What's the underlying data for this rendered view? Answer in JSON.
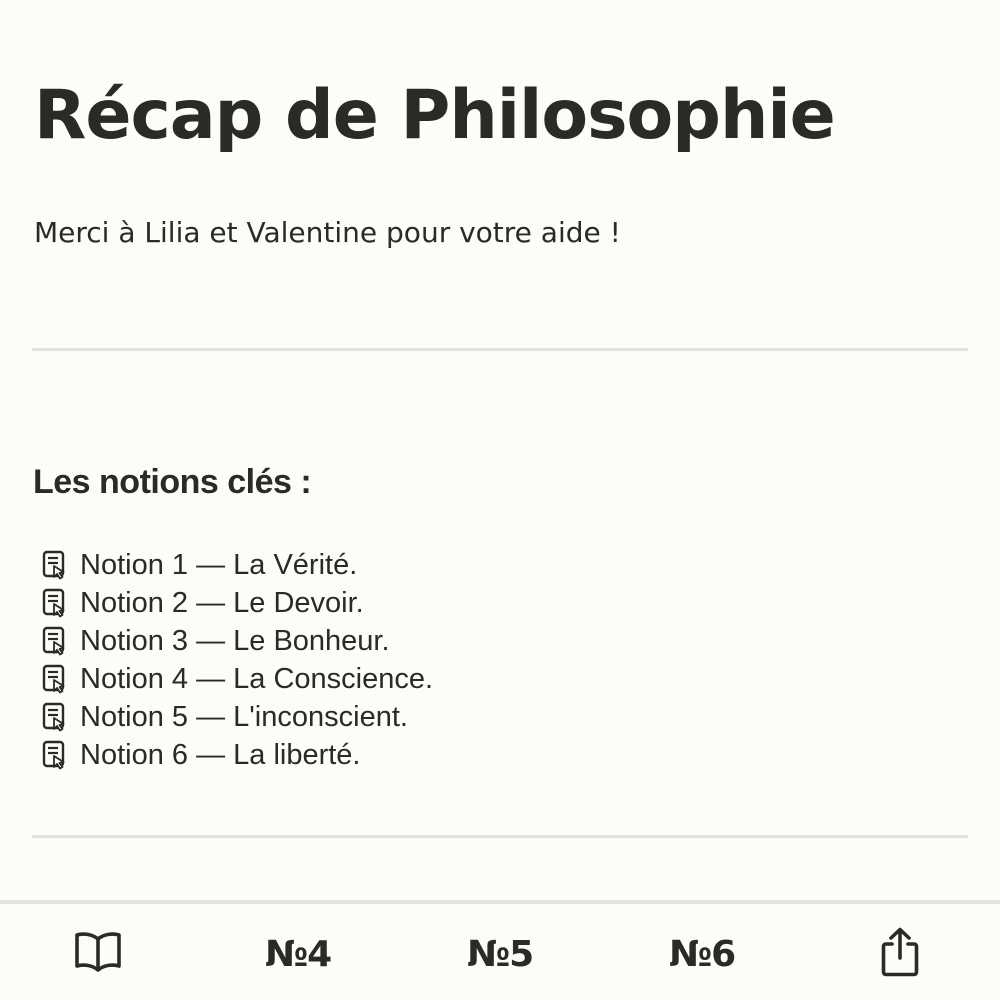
{
  "header": {
    "title": "Récap de Philosophie",
    "subtitle": "Merci à Lilia et Valentine pour votre aide !"
  },
  "notions": {
    "heading": "Les notions clés :",
    "icon": "document-pointer-icon",
    "items": [
      "Notion 1 — La Vérité.",
      "Notion 2 — Le Devoir.",
      "Notion 3 — Le Bonheur.",
      "Notion 4 — La Conscience.",
      "Notion 5 — L'inconscient.",
      "Notion 6 — La liberté."
    ]
  },
  "bottom_bar": {
    "book_icon": "open-book-icon",
    "items": [
      "№4",
      "№5",
      "№6"
    ],
    "share_icon": "share-icon"
  },
  "colors": {
    "background": "#fdfcf8",
    "text": "#2b2a26",
    "divider": "#e4e2dc"
  }
}
